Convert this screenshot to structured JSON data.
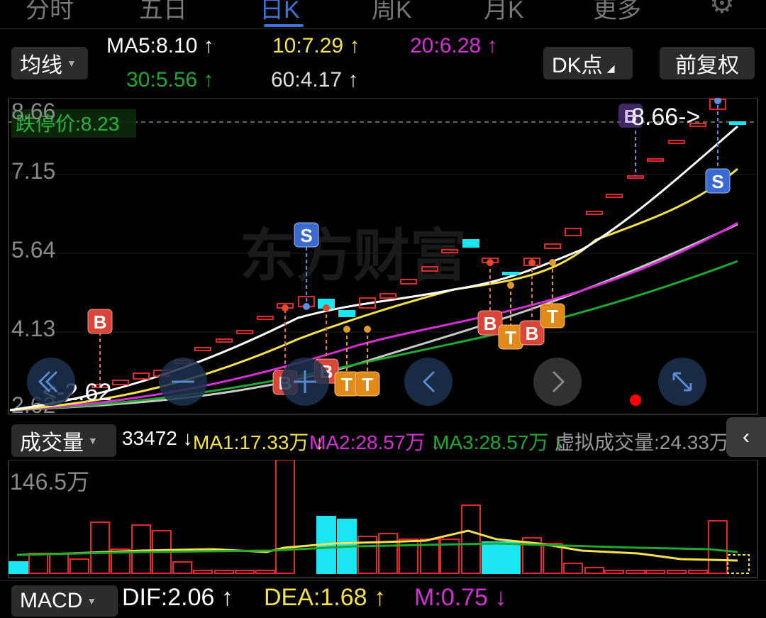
{
  "tabs": [
    "分时",
    "五日",
    "日K",
    "周K",
    "月K",
    "更多"
  ],
  "indicator": {
    "ma_select": "均线",
    "ma5": "MA5:8.10 ↑",
    "ma10": "10:7.29 ↑",
    "ma20": "20:6.28 ↑",
    "ma30": "30:5.56 ↑",
    "ma60": "60:4.17 ↑",
    "dk_button": "DK点",
    "fq_button": "前复权"
  },
  "price_axis": [
    "8.66",
    "7.15",
    "5.64",
    "4.13",
    "2.62"
  ],
  "limit_label": "跌停价:8.23",
  "high_label": "8.66->",
  "low_label": "<-2.62",
  "watermark": "东方财富",
  "signals": {
    "b": "B",
    "s": "S",
    "t": "T"
  },
  "volume": {
    "select": "成交量",
    "last": "33472 ↓",
    "ma1": "MA1:17.33万 ↓",
    "ma2": "MA2:28.57万 ↓",
    "ma3": "MA3:28.57万 ↓",
    "virtual": "虚拟成交量:24.33万",
    "axis_max": "146.5万"
  },
  "macd": {
    "select": "MACD",
    "dif": "DIF:2.06 ↑",
    "dea": "DEA:1.68 ↑",
    "m": "M:0.75 ↓"
  },
  "colors": {
    "up": "#e02a2a",
    "down": "#19e6f0",
    "ma5": "#ffffff",
    "ma10": "#f5e14a",
    "ma20": "#d62ed6",
    "ma30": "#1fa82e",
    "ma60": "#c8c8c8",
    "accent": "#3b74d6"
  }
}
